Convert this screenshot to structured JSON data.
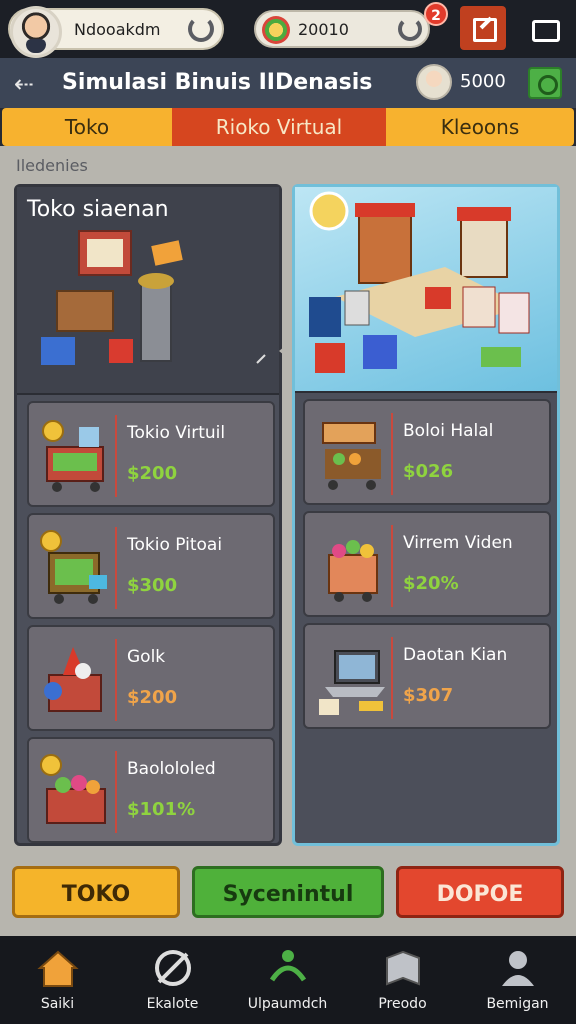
{
  "topbar": {
    "player_name": "Ndooakdm",
    "coin_value": "20010",
    "notification_count": "2"
  },
  "header": {
    "title": "Simulasi Binuis IIDenasis",
    "balance": "5000"
  },
  "tabs": [
    {
      "label": "Toko"
    },
    {
      "label": "Rioko Virtual"
    },
    {
      "label": "Kleoons"
    }
  ],
  "section_label": "Iledenies",
  "left_panel": {
    "hero_title": "Toko siaenan",
    "items": [
      {
        "name": "Tokio Virtuil",
        "price": "$200"
      },
      {
        "name": "Tokio Pitoai",
        "price": "$300"
      },
      {
        "name": "Golk",
        "price": "$200"
      },
      {
        "name": "Baolololed",
        "price": "$101%"
      }
    ]
  },
  "right_panel": {
    "items": [
      {
        "name": "Boloi Halal",
        "price": "$026"
      },
      {
        "name": "Virrem Viden",
        "price": "$20%"
      },
      {
        "name": "Daotan Kian",
        "price": "$307"
      }
    ]
  },
  "actions": {
    "toko": "TOKO",
    "sycennul": "Sycenintul",
    "dopoe": "DOPOE"
  },
  "nav": [
    {
      "label": "Saiki",
      "icon": "home-icon"
    },
    {
      "label": "Ekalote",
      "icon": "shop-icon"
    },
    {
      "label": "Ulpaumdch",
      "icon": "growth-icon"
    },
    {
      "label": "Preodo",
      "icon": "book-icon"
    },
    {
      "label": "Bemigan",
      "icon": "profile-icon"
    }
  ],
  "colors": {
    "accent_orange": "#f7b22f",
    "accent_red": "#d6461f",
    "accent_green": "#4fb13a",
    "price_green": "#8fd33f",
    "price_orange": "#f0a44a"
  }
}
